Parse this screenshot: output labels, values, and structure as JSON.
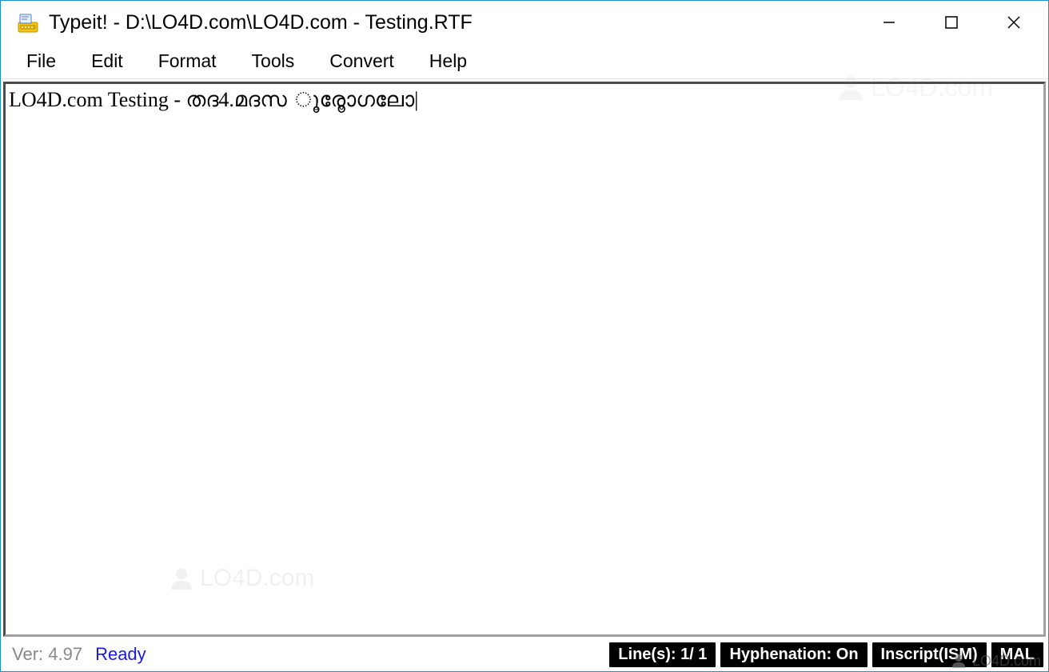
{
  "window": {
    "title": "Typeit! - D:\\LO4D.com\\LO4D.com - Testing.RTF"
  },
  "menu": {
    "items": [
      "File",
      "Edit",
      "Format",
      "Tools",
      "Convert",
      "Help"
    ]
  },
  "document": {
    "content": "LO4D.com Testing - തദ4.മദസ ൂരോൂഗലോ"
  },
  "status": {
    "version": "Ver: 4.97",
    "state": "Ready",
    "lines": "Line(s):  1/ 1",
    "hyphenation": "Hyphenation: On",
    "keyboard": "Inscript(ISM)",
    "language": "MAL"
  },
  "watermark": "LO4D.com"
}
